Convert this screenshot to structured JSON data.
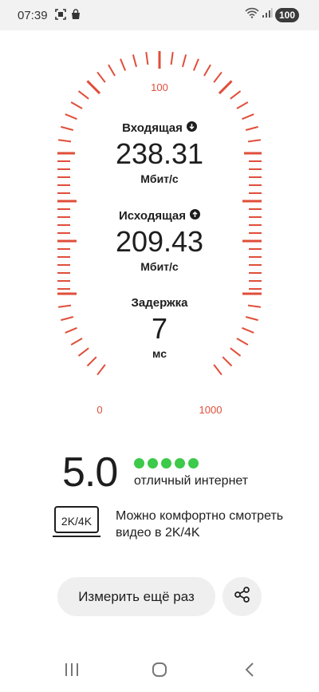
{
  "status_bar": {
    "time": "07:39",
    "battery": "100",
    "icons": [
      "screenshot-icon",
      "shopping-bag-icon",
      "wifi-icon",
      "signal-icon"
    ]
  },
  "gauge": {
    "min_label": "0",
    "mid_label": "100",
    "max_label": "1000",
    "tick_color": "#e04e3a"
  },
  "download": {
    "label": "Входящая",
    "value": "238.31",
    "unit": "Мбит/с",
    "icon": "arrow-down-icon"
  },
  "upload": {
    "label": "Исходящая",
    "value": "209.43",
    "unit": "Мбит/с",
    "icon": "arrow-up-icon"
  },
  "ping": {
    "label": "Задержка",
    "value": "7",
    "unit": "мс"
  },
  "rating": {
    "score": "5.0",
    "stars": 5,
    "max_stars": 5,
    "dot_color": "#3dc94a",
    "text": "отличный интернет"
  },
  "video": {
    "badge": "2K/4K",
    "text": "Можно комфортно смотреть видео в 2K/4K"
  },
  "actions": {
    "remeasure_label": "Измерить ещё раз",
    "share_icon": "share-icon"
  },
  "nav": {
    "items": [
      "recent-apps-icon",
      "home-icon",
      "back-icon"
    ]
  }
}
